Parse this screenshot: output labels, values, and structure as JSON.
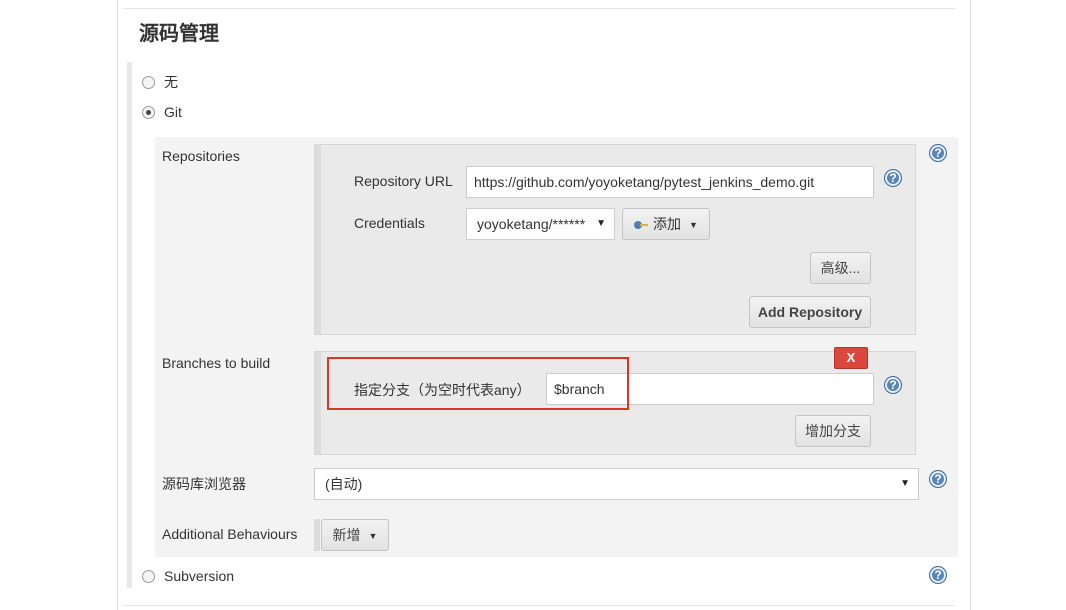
{
  "section_title": "源码管理",
  "scm": {
    "options": [
      {
        "label": "无",
        "selected": false
      },
      {
        "label": "Git",
        "selected": true
      },
      {
        "label": "Subversion",
        "selected": false
      }
    ]
  },
  "repositories": {
    "label": "Repositories",
    "repository_url_label": "Repository URL",
    "repository_url_value": "https://github.com/yoyoketang/pytest_jenkins_demo.git",
    "credentials_label": "Credentials",
    "credentials_value": "yoyoketang/******",
    "add_button_label": "添加",
    "advanced_button_label": "高级...",
    "add_repository_button_label": "Add Repository"
  },
  "branches": {
    "label": "Branches to build",
    "delete_label": "X",
    "branch_specifier_label": "指定分支（为空时代表any）",
    "branch_specifier_value": "$branch",
    "add_branch_button_label": "增加分支"
  },
  "repo_browser": {
    "label": "源码库浏览器",
    "value": "(自动)"
  },
  "additional_behaviours": {
    "label": "Additional Behaviours",
    "add_button_label": "新增"
  },
  "help_icon_glyph": "?",
  "colors": {
    "highlight": "#d9362a",
    "delete_button": "#d9473d",
    "help_icon": "#5a86b7"
  }
}
